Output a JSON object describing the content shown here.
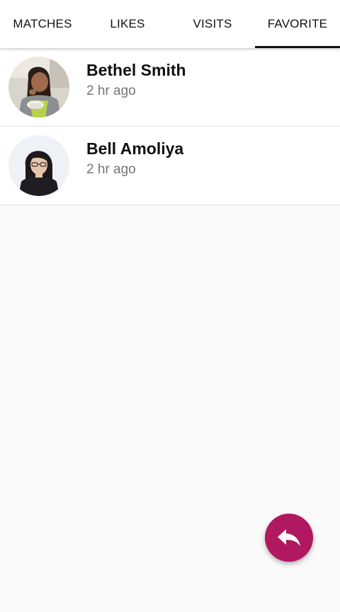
{
  "tabs": [
    {
      "label": "MATCHES",
      "active": false
    },
    {
      "label": "LIKES",
      "active": false
    },
    {
      "label": "VISITS",
      "active": false
    },
    {
      "label": "FAVORITE",
      "active": true
    }
  ],
  "favorites": [
    {
      "name": "Bethel Smith",
      "time": "2 hr ago",
      "avatar": "woman-eating-photo"
    },
    {
      "name": "Bell Amoliya",
      "time": "2 hr ago",
      "avatar": "woman-glasses-photo"
    }
  ],
  "fab": {
    "icon": "reply-icon",
    "color": "#b0185f"
  },
  "colors": {
    "background": "#fafafa",
    "tab_indicator": "#111111",
    "secondary_text": "#757575"
  }
}
